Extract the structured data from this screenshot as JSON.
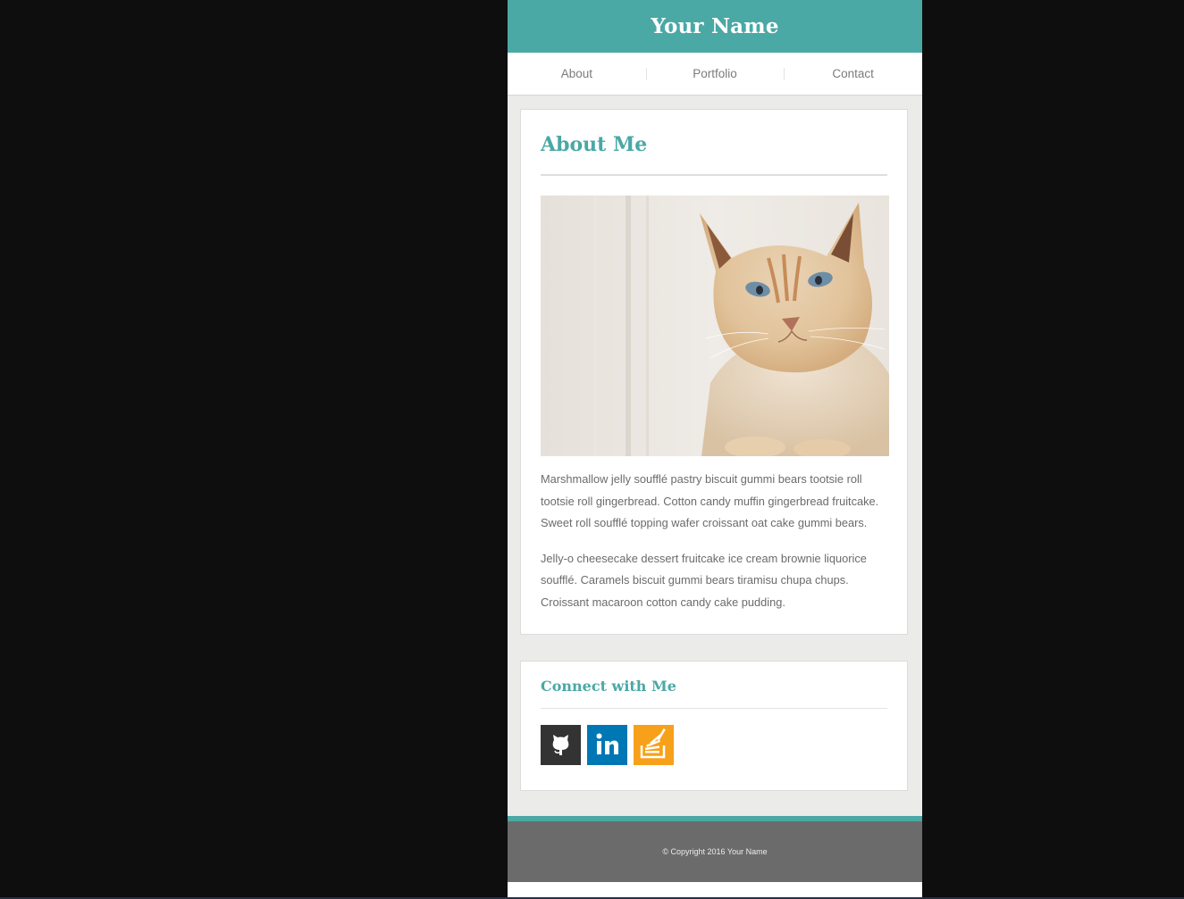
{
  "site": {
    "title": "Your Name"
  },
  "nav": {
    "items": [
      {
        "label": "About"
      },
      {
        "label": "Portfolio"
      },
      {
        "label": "Contact"
      }
    ]
  },
  "about": {
    "heading": "About Me",
    "photo_alt": "cat-photo",
    "paragraphs": [
      "Marshmallow jelly soufflé pastry biscuit gummi bears tootsie roll tootsie roll gingerbread. Cotton candy muffin gingerbread fruitcake. Sweet roll soufflé topping wafer croissant oat cake gummi bears.",
      "Jelly-o cheesecake dessert fruitcake ice cream brownie liquorice soufflé. Caramels biscuit gummi bears tiramisu chupa chups. Croissant macaroon cotton candy cake pudding."
    ]
  },
  "connect": {
    "heading": "Connect with Me",
    "links": [
      {
        "icon": "github-icon",
        "color": "#333333"
      },
      {
        "icon": "linkedin-icon",
        "color": "#0077b5"
      },
      {
        "icon": "stackoverflow-icon",
        "color": "#f7a11a"
      }
    ]
  },
  "footer": {
    "copyright": "© Copyright 2016 Your Name"
  },
  "colors": {
    "accent": "#4aa8a5",
    "footer_bg": "#6b6b6b"
  }
}
